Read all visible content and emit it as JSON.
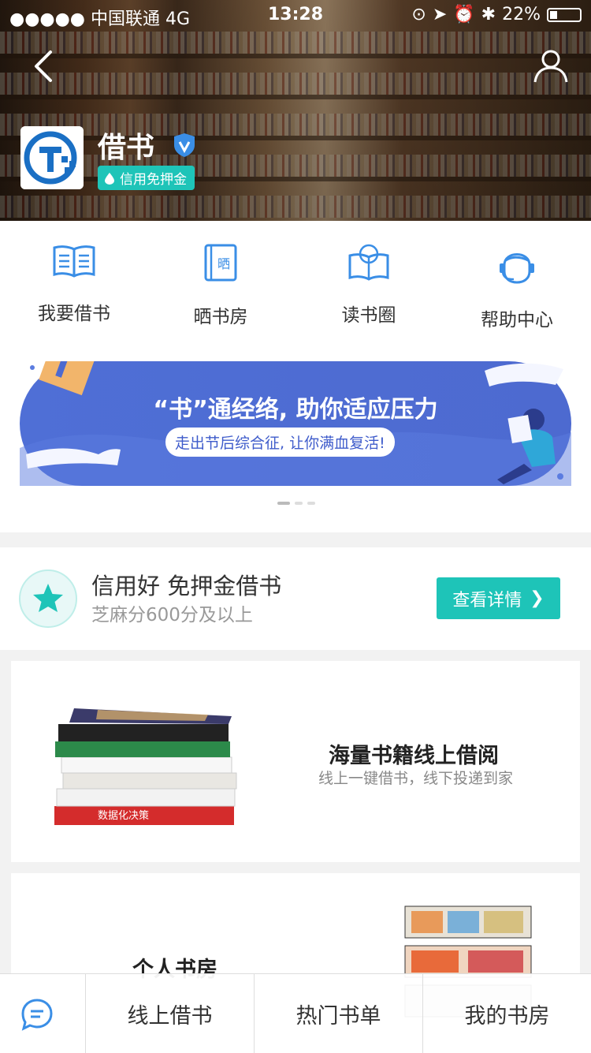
{
  "status_bar": {
    "carrier": "●●●●● 中国联通  4G",
    "time": "13:28",
    "battery": "22%",
    "battery_level": 0.22
  },
  "header": {
    "app_name": "借书",
    "credit_badge": "信用免押金"
  },
  "nav": [
    {
      "label": "我要借书",
      "icon": "open-book-icon"
    },
    {
      "label": "晒书房",
      "icon": "bookroom-icon"
    },
    {
      "label": "读书圈",
      "icon": "reading-circle-icon"
    },
    {
      "label": "帮助中心",
      "icon": "customer-service-icon"
    }
  ],
  "banner": {
    "title": "“书”通经络, 助你适应压力",
    "subtitle": "走出节后综合征, 让你满血复活!"
  },
  "credit": {
    "title": "信用好 免押金借书",
    "subtitle": "芝麻分600分及以上",
    "button": "查看详情"
  },
  "cards": [
    {
      "title": "海量书籍线上借阅",
      "subtitle": "线上一键借书，线下投递到家"
    },
    {
      "title": "个人书房"
    }
  ],
  "tabbar": {
    "tabs": [
      "线上借书",
      "热门书单",
      "我的书房"
    ]
  },
  "colors": {
    "accent": "#1ec4b8",
    "banner": "#4f6fd6",
    "icon_blue": "#3a8ee6"
  }
}
